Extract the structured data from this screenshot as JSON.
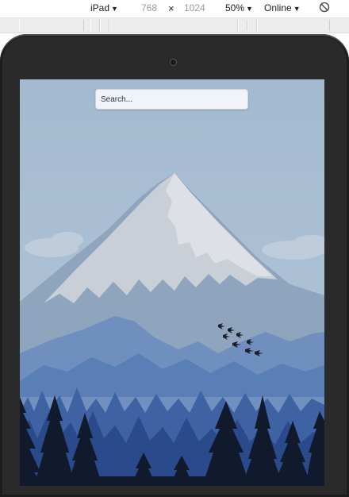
{
  "toolbar": {
    "device": "iPad",
    "width": "768",
    "times": "×",
    "height": "1024",
    "zoom": "50%",
    "network": "Online",
    "caret": "▼"
  },
  "icons": {
    "device_caret": "chevron-down-icon",
    "rotate": "rotate-icon",
    "camera": "camera-icon"
  },
  "page": {
    "search": {
      "placeholder": "Search..."
    },
    "background": "mountain-landscape"
  },
  "colors": {
    "sky": "#a9bfd3",
    "snow": "#d4d8dd",
    "bezel": "#2a2a2a",
    "forest": "#1e3566"
  }
}
